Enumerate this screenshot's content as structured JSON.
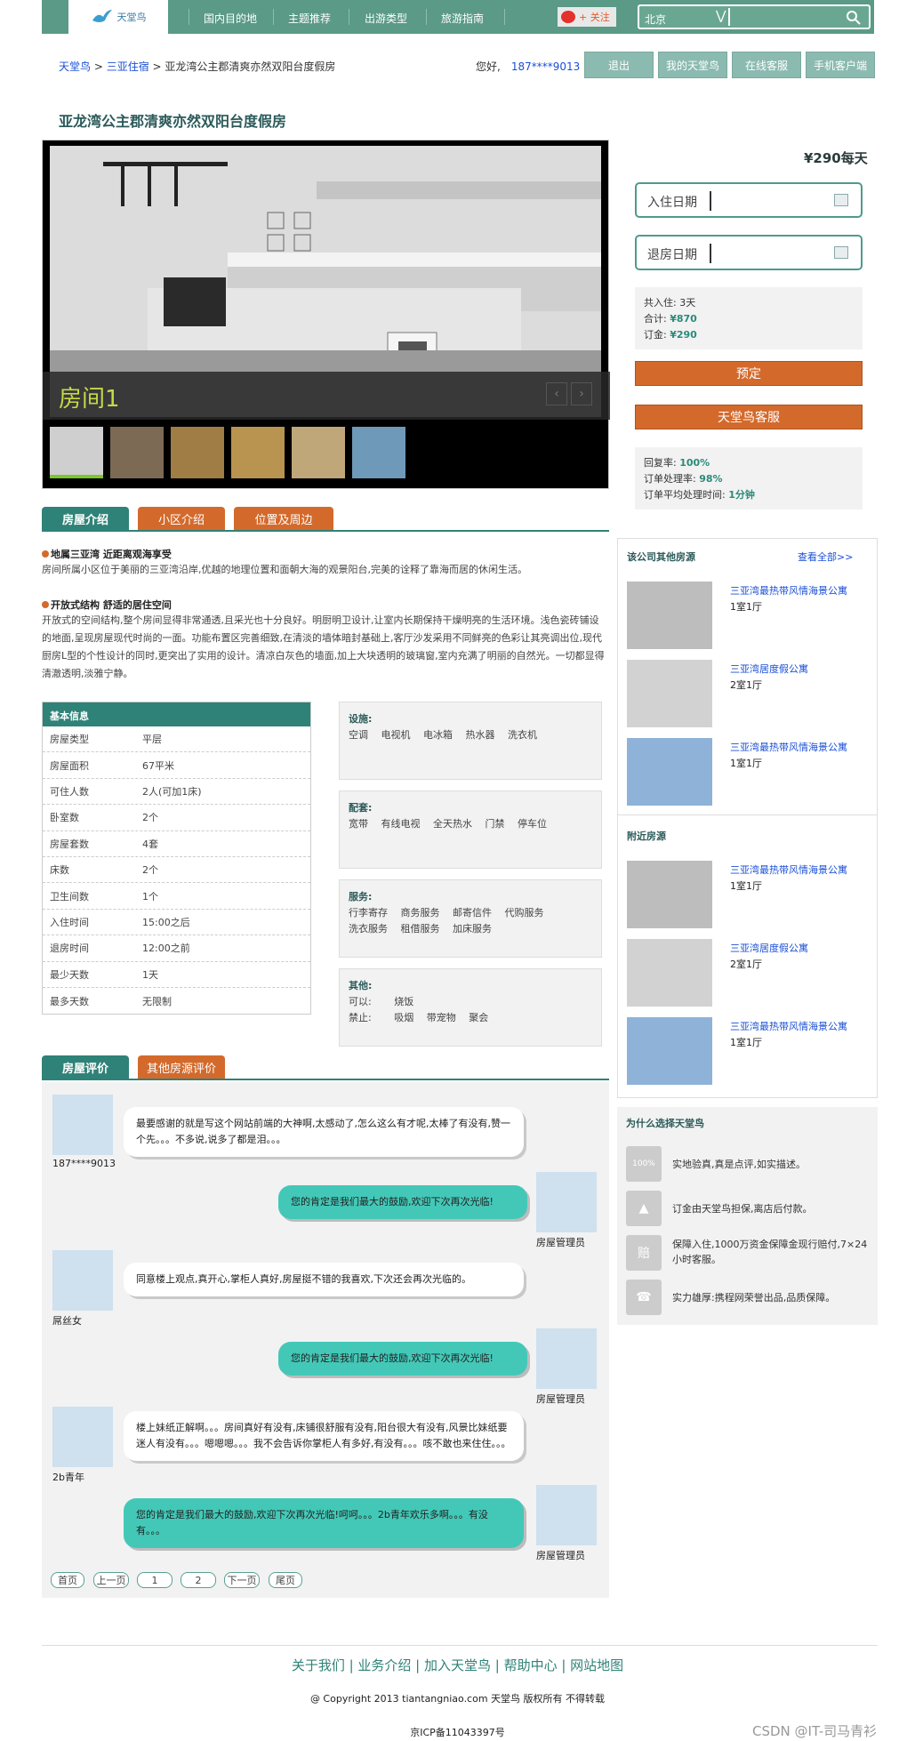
{
  "brand": {
    "logo_text": "天堂鸟",
    "colors": {
      "primary": "#2f8277",
      "accent": "#d36a2c"
    }
  },
  "nav": {
    "items": [
      "国内目的地",
      "主题推荐",
      "出游类型",
      "旅游指南"
    ],
    "weibo_label": "+ 关注",
    "city": "北京"
  },
  "breadcrumb": {
    "home": "天堂鸟",
    "city": "三亚住宿",
    "current": "亚龙湾公主郡清爽亦然双阳台度假房"
  },
  "user": {
    "greeting": "您好,",
    "id": "187****9013"
  },
  "top_buttons": [
    "退出",
    "我的天堂鸟",
    "在线客服",
    "手机客户端"
  ],
  "page_title": "亚龙湾公主郡清爽亦然双阳台度假房",
  "gallery": {
    "room_label": "房间1"
  },
  "booking": {
    "price": "¥290每天",
    "price_value": "290",
    "checkin": "入住日期",
    "checkout": "退房日期",
    "total_days": "共入住: 3天",
    "total_label": "合计:",
    "total": "¥870",
    "deposit_label": "订金:",
    "deposit": "¥290",
    "book_btn": "预定",
    "service_btn": "天堂鸟客服",
    "reply_label": "回复率:",
    "reply": "100%",
    "handle_label": "订单处理率:",
    "handle": "98%",
    "avg_label": "订单平均处理时间:",
    "avg": "1分钟"
  },
  "tabs": [
    "房屋介绍",
    "小区介绍",
    "位置及周边"
  ],
  "desc": [
    {
      "head": "地属三亚湾 近距离观海享受",
      "body": "房间所属小区位于美丽的三亚湾沿岸,优越的地理位置和面朝大海的观景阳台,完美的诠释了靠海而居的休闲生活。"
    },
    {
      "head": "开放式结构 舒适的居住空间",
      "body": "开放式的空间结构,整个房间显得非常通透,且采光也十分良好。明厨明卫设计,让室内长期保持干燥明亮的生活环境。浅色瓷砖铺设的地面,呈现房屋现代时尚的一面。功能布置区完善细致,在清淡的墙体暗封基础上,客厅沙发采用不同鲜亮的色彩让其亮调出位,现代厨房L型的个性设计的同时,更突出了实用的设计。清凉白灰色的墙面,加上大块透明的玻璃窗,室内充满了明丽的自然光。一切都显得清澈透明,淡雅宁静。"
    }
  ],
  "basic": {
    "title": "基本信息",
    "rows": [
      [
        "房屋类型",
        "平层"
      ],
      [
        "房屋面积",
        "67平米"
      ],
      [
        "可住人数",
        "2人(可加1床)"
      ],
      [
        "卧室数",
        "2个"
      ],
      [
        "房屋套数",
        "4套"
      ],
      [
        "床数",
        "2个"
      ],
      [
        "卫生间数",
        "1个"
      ],
      [
        "入住时间",
        "15:00之后"
      ],
      [
        "退房时间",
        "12:00之前"
      ],
      [
        "最少天数",
        "1天"
      ],
      [
        "最多天数",
        "无限制"
      ]
    ]
  },
  "facilities": [
    {
      "title": "设施:",
      "lines": [
        "空调　 电视机　 电冰箱　 热水器　 洗衣机"
      ]
    },
    {
      "title": "配套:",
      "lines": [
        "宽带　 有线电视　 全天热水　 门禁　 停车位"
      ]
    },
    {
      "title": "服务:",
      "lines": [
        "行李寄存　 商务服务　 邮寄信件　 代购服务",
        "洗衣服务　 租借服务　 加床服务"
      ]
    },
    {
      "title": "其他:",
      "lines": [
        "可以:　　 烧饭",
        "禁止:　　 吸烟　 带宠物　 聚会"
      ]
    }
  ],
  "sidebar": {
    "other_title": "该公司其他房源",
    "more": "查看全部>>",
    "nearby_title": "附近房源",
    "other": [
      {
        "name": "三亚湾最热带风情海景公寓",
        "sub": "1室1厅"
      },
      {
        "name": "三亚湾居度假公寓",
        "sub": "2室1厅"
      },
      {
        "name": "三亚湾最热带风情海景公寓",
        "sub": "1室1厅"
      }
    ],
    "nearby": [
      {
        "name": "三亚湾最热带风情海景公寓",
        "sub": "1室1厅"
      },
      {
        "name": "三亚湾居度假公寓",
        "sub": "2室1厅"
      },
      {
        "name": "三亚湾最热带风情海景公寓",
        "sub": "1室1厅"
      }
    ]
  },
  "why": {
    "title": "为什么选择天堂鸟",
    "items": [
      {
        "icon": "100%",
        "text": "实地验真,真是点评,如实描述。"
      },
      {
        "icon": "",
        "text": "订金由天堂鸟担保,离店后付款。"
      },
      {
        "icon": "赔",
        "text": "保障入住,1000万资金保障金现行赔付,7×24小时客服。"
      },
      {
        "icon": "☎",
        "text": "实力雄厚:携程网荣誉出品,品质保障。"
      }
    ]
  },
  "review_tabs": [
    "房屋评价",
    "其他房源评价"
  ],
  "reviews": [
    {
      "name": "187****9013",
      "text": "最要感谢的就是写这个网站前端的大神啊,太感动了,怎么这么有才呢,太棒了有没有,赞一个先。。。不多说,说多了都是泪。。。"
    },
    {
      "name": "房屋管理员",
      "text": "您的肯定是我们最大的鼓励,欢迎下次再次光临!"
    },
    {
      "name": "屌丝女",
      "text": "同意楼上观点,真开心,掌柜人真好,房屋挺不错的我喜欢,下次还会再次光临的。"
    },
    {
      "name": "房屋管理员",
      "text": "您的肯定是我们最大的鼓励,欢迎下次再次光临!"
    },
    {
      "name": "2b青年",
      "text": "楼上妹纸正解啊。。。房间真好有没有,床铺很舒服有没有,阳台很大有没有,风景比妹纸要迷人有没有。。。嗯嗯嗯。。。我不会告诉你掌柜人有多好,有没有。。。咳不敢也来住住。。。"
    },
    {
      "name": "房屋管理员",
      "text": "您的肯定是我们最大的鼓励,欢迎下次再次光临!呵呵。。。2b青年欢乐多啊。。。有没有。。。"
    }
  ],
  "pager": [
    "首页",
    "上一页",
    "1",
    "2",
    "下一页",
    "尾页"
  ],
  "footer": {
    "links": "关于我们 | 业务介绍 | 加入天堂鸟 | 帮助中心 | 网站地图",
    "copyright": "@ Copyright 2013 tiantangniao.com 天堂鸟 版权所有 不得转载",
    "icp": "京ICP备11043397号"
  },
  "watermark": "CSDN @IT-司马青衫"
}
